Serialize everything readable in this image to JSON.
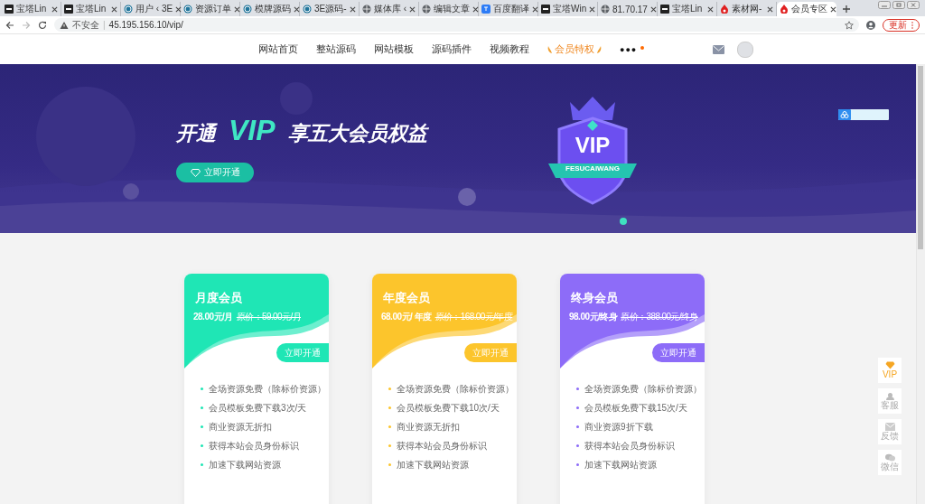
{
  "browser": {
    "tabs": [
      {
        "title": "宝塔Lin",
        "kind": "bt",
        "selected": false
      },
      {
        "title": "宝塔Lin",
        "kind": "bt",
        "selected": false
      },
      {
        "title": "用户 ‹ 3E",
        "kind": "wp",
        "selected": false
      },
      {
        "title": "资源订单",
        "kind": "wp",
        "selected": false
      },
      {
        "title": "模牌源码",
        "kind": "wp",
        "selected": false
      },
      {
        "title": "3E源码-",
        "kind": "wp",
        "selected": false
      },
      {
        "title": "媒体库 ‹",
        "kind": "globe",
        "selected": false
      },
      {
        "title": "编辑文章",
        "kind": "globe",
        "selected": false
      },
      {
        "title": "百度翻译",
        "kind": "translate",
        "selected": false
      },
      {
        "title": "宝塔Win",
        "kind": "bt",
        "selected": false
      },
      {
        "title": "81.70.17",
        "kind": "globe",
        "selected": false
      },
      {
        "title": "宝塔Lin",
        "kind": "bt",
        "selected": false
      },
      {
        "title": "素材网-",
        "kind": "flame",
        "selected": false
      },
      {
        "title": "会员专区",
        "kind": "flame",
        "selected": true
      }
    ],
    "security": "不安全",
    "separator": "|",
    "url": "45.195.156.10/vip/",
    "update_button": "更新"
  },
  "nav": {
    "items": [
      {
        "label": "网站首页",
        "selected": false
      },
      {
        "label": "整站源码",
        "selected": false
      },
      {
        "label": "网站模板",
        "selected": false
      },
      {
        "label": "源码插件",
        "selected": false
      },
      {
        "label": "视频教程",
        "selected": false
      },
      {
        "label": "会员特权",
        "selected": true
      }
    ],
    "more": "●●●"
  },
  "banner": {
    "title_prefix": "开通",
    "title_vip": "VIP",
    "title_suffix": "享五大会员权益",
    "button": "立即开通",
    "badge_text": "VIP",
    "badge_ribbon": "FESUCAIWANG"
  },
  "plans": [
    {
      "name": "月度会员",
      "price": "28.00元/月",
      "original_price": "原价：59.00元/月",
      "button": "立即开通",
      "color": "#1fe6b5",
      "features": [
        "全场资源免费（除标价资源）",
        "会员模板免费下载3次/天",
        "商业资源无折扣",
        "获得本站会员身份标识",
        "加速下载网站资源"
      ]
    },
    {
      "name": "年度会员",
      "price": "68.00元/ 年度",
      "original_price": "原价：168.00元/年度",
      "button": "立即开通",
      "color": "#fcc52c",
      "features": [
        "全场资源免费（除标价资源）",
        "会员模板免费下载10次/天",
        "商业资源无折扣",
        "获得本站会员身份标识",
        "加速下载网站资源"
      ]
    },
    {
      "name": "终身会员",
      "price": "98.00元/终身",
      "original_price": "原价：388.00元/终身",
      "button": "立即开通",
      "color": "#8d6cf8",
      "features": [
        "全场资源免费（除标价资源）",
        "会员模板免费下载15次/天",
        "商业资源9折下载",
        "获得本站会员身份标识",
        "加速下载网站资源"
      ]
    }
  ],
  "sidebar": [
    {
      "label": "VIP",
      "kind": "vip"
    },
    {
      "label": "客服",
      "kind": "support"
    },
    {
      "label": "反馈",
      "kind": "mail"
    },
    {
      "label": "微信",
      "kind": "chat"
    }
  ]
}
